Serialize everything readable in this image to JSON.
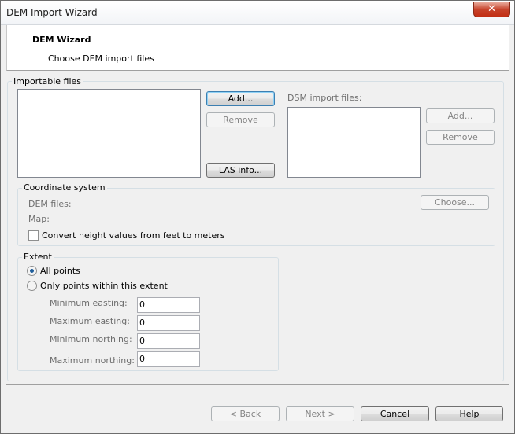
{
  "window": {
    "title": "DEM Import Wizard",
    "close_glyph": "✕"
  },
  "header": {
    "title": "DEM Wizard",
    "subtitle": "Choose DEM import files"
  },
  "importable": {
    "group_label": "Importable files",
    "add_label": "Add...",
    "remove_label": "Remove",
    "las_info_label": "LAS info...",
    "dsm_label": "DSM import files:",
    "dsm_add_label": "Add...",
    "dsm_remove_label": "Remove"
  },
  "coordinate": {
    "group_label": "Coordinate system",
    "dem_files_label": "DEM files:",
    "map_label": "Map:",
    "choose_label": "Choose...",
    "convert_label": "Convert height values from feet to meters"
  },
  "extent": {
    "group_label": "Extent",
    "all_points_label": "All points",
    "only_points_label": "Only points within this extent",
    "min_easting_label": "Minimum easting:",
    "max_easting_label": "Maximum easting:",
    "min_northing_label": "Minimum northing:",
    "max_northing_label": "Maximum northing:",
    "min_easting_value": "0",
    "max_easting_value": "0",
    "min_northing_value": "0",
    "max_northing_value": "0"
  },
  "footer": {
    "back_label": "< Back",
    "next_label": "Next >",
    "cancel_label": "Cancel",
    "help_label": "Help"
  }
}
